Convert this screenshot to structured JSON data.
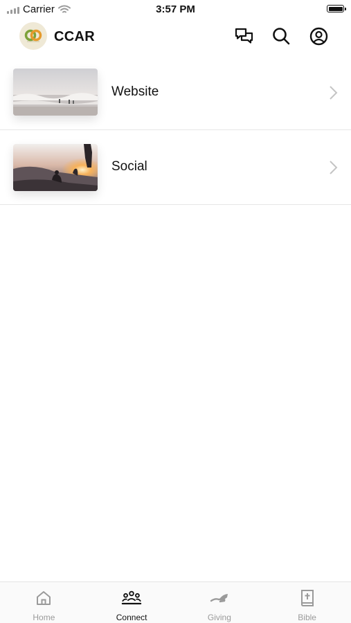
{
  "status_bar": {
    "carrier": "Carrier",
    "time": "3:57 PM"
  },
  "header": {
    "title": "CCAR",
    "logo_icon": "ccar-logo-icon",
    "actions": [
      {
        "icon": "chat-bubbles-icon"
      },
      {
        "icon": "search-icon"
      },
      {
        "icon": "profile-icon"
      }
    ]
  },
  "list": {
    "items": [
      {
        "label": "Website",
        "thumbnail": "beach-waves-photo"
      },
      {
        "label": "Social",
        "thumbnail": "sunset-silhouettes-photo"
      }
    ]
  },
  "tab_bar": {
    "active": "Connect",
    "tabs": [
      {
        "label": "Home",
        "icon": "home-icon"
      },
      {
        "label": "Connect",
        "icon": "people-group-icon"
      },
      {
        "label": "Giving",
        "icon": "giving-hand-icon"
      },
      {
        "label": "Bible",
        "icon": "bible-book-icon"
      }
    ]
  },
  "colors": {
    "text_primary": "#111111",
    "text_inactive": "#9a9a9a",
    "divider": "#e6e6e6",
    "logo_background": "#efe9d6",
    "logo_green": "#7ca23a",
    "logo_orange": "#e59a2c"
  }
}
